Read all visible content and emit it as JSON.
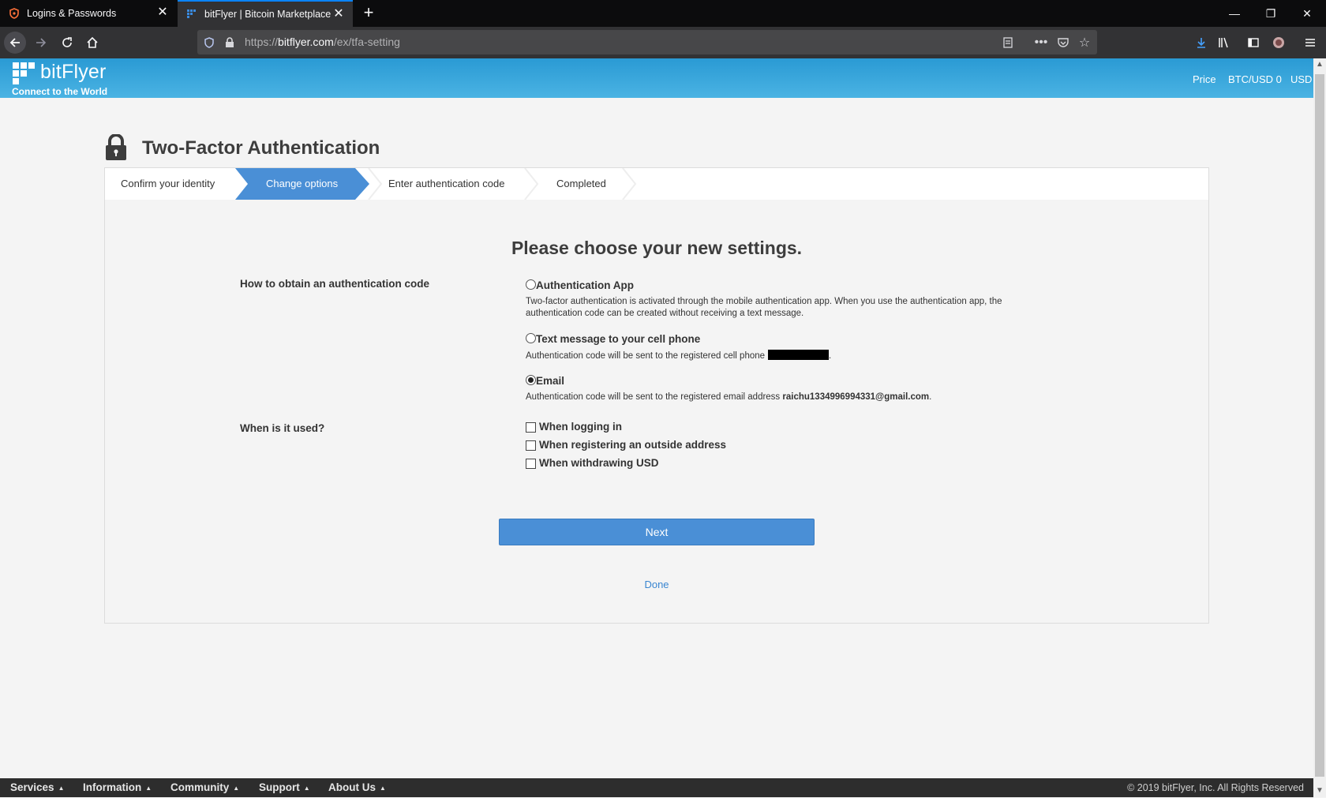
{
  "browser": {
    "tabs": [
      {
        "title": "Logins & Passwords",
        "icon": "lockwise-icon",
        "active": false
      },
      {
        "title": "bitFlyer | Bitcoin Marketplace",
        "icon": "bitflyer-favicon",
        "active": true
      }
    ],
    "url_scheme": "https://",
    "url_host": "bitflyer.com",
    "url_path": "/ex/tfa-setting"
  },
  "header": {
    "logo_text": "bitFlyer",
    "tagline": "Connect to the World",
    "price_label": "Price",
    "price_value": "BTC/USD 0",
    "currency": "USD"
  },
  "page": {
    "title": "Two-Factor Authentication",
    "steps": [
      {
        "label": "Confirm your identity",
        "active": false
      },
      {
        "label": "Change options",
        "active": true
      },
      {
        "label": "Enter authentication code",
        "active": false
      },
      {
        "label": "Completed",
        "active": false
      }
    ],
    "heading": "Please choose your new settings.",
    "method_label": "How to obtain an authentication code",
    "methods": [
      {
        "title": "Authentication App",
        "desc": "Two-factor authentication is activated through the mobile authentication app. When you use the authentication app, the authentication code can be created without receiving a text message.",
        "checked": false
      },
      {
        "title": "Text message to your cell phone",
        "desc": "Authentication code will be sent to the registered cell phone",
        "desc_end": ".",
        "checked": false
      },
      {
        "title": "Email",
        "desc": "Authentication code will be sent to the registered email address",
        "email": "raichu1334996994331@gmail.com",
        "desc_end": ".",
        "checked": true
      }
    ],
    "usage_label": "When is it used?",
    "usage_options": [
      {
        "label": "When logging in",
        "checked": false
      },
      {
        "label": "When registering an outside address",
        "checked": false
      },
      {
        "label": "When withdrawing USD",
        "checked": false
      }
    ],
    "next_label": "Next",
    "done_label": "Done"
  },
  "footer": {
    "items": [
      "Services",
      "Information",
      "Community",
      "Support",
      "About Us"
    ],
    "copyright": "© 2019 bitFlyer, Inc. All Rights Reserved"
  },
  "colors": {
    "header_blue": "#2a9ad4",
    "accent_blue": "#4a8fd6",
    "link_blue": "#3a86d1",
    "footer_bg": "#2d2d2d"
  }
}
